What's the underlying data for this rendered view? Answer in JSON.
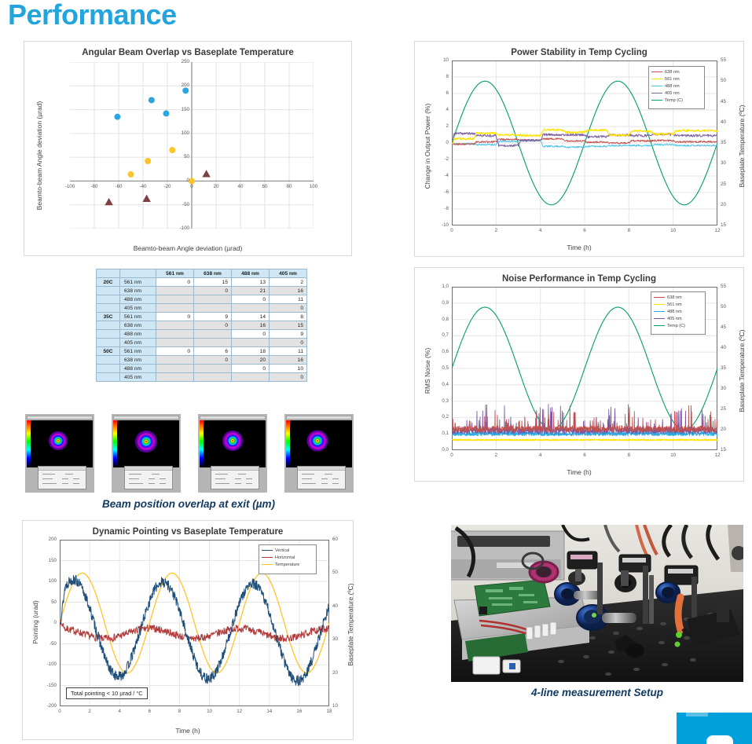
{
  "slide": {
    "title": "Performance"
  },
  "captions": {
    "beam_overlap": "Beam position overlap at exit (µm)",
    "setup": "4-line measurement Setup"
  },
  "scatter_chart": {
    "chart_data": {
      "type": "scatter",
      "title": "Angular Beam Overlap vs Baseplate Temperature",
      "xlabel": "Beamto-beam Angle deviation (µrad)",
      "ylabel": "Beamto-beam Angle deviation (µrad)",
      "xlim": [
        -100,
        100
      ],
      "ylim": [
        -100,
        250
      ],
      "xticks": [
        -100,
        -80,
        -60,
        -40,
        -20,
        0,
        20,
        40,
        60,
        80,
        100
      ],
      "yticks": [
        -100,
        -50,
        0,
        50,
        100,
        150,
        200,
        250
      ],
      "grid": true,
      "series": [
        {
          "name": "blue-circles",
          "color": "#2BA6DE",
          "marker": "circle",
          "points": [
            [
              -61,
              135
            ],
            [
              -33,
              170
            ],
            [
              -21,
              142
            ],
            [
              -5,
              190
            ]
          ]
        },
        {
          "name": "yellow-circles",
          "color": "#FFC425",
          "marker": "circle",
          "points": [
            [
              -50,
              14
            ],
            [
              -36,
              42
            ],
            [
              -16,
              65
            ],
            [
              0,
              0
            ]
          ]
        },
        {
          "name": "brown-triangles",
          "color": "#7D4141",
          "marker": "triangle",
          "points": [
            [
              -68,
              -44
            ],
            [
              -37,
              -37
            ],
            [
              12,
              15
            ]
          ]
        }
      ]
    }
  },
  "power_chart": {
    "chart_data": {
      "type": "line",
      "title": "Power Stability in Temp Cycling",
      "xlabel": "Time (h)",
      "ylabel": "Change in Output Power (%)",
      "y2label": "Baseplate Temperature (ºC)",
      "xlim": [
        0,
        12
      ],
      "ylim": [
        -10,
        10
      ],
      "y2lim": [
        15,
        55
      ],
      "xticks": [
        0,
        2,
        4,
        6,
        8,
        10,
        12
      ],
      "yticks": [
        -10,
        -8,
        -6,
        -4,
        -2,
        0,
        2,
        4,
        6,
        8,
        10
      ],
      "y2ticks": [
        15,
        20,
        25,
        30,
        35,
        40,
        45,
        50,
        55
      ],
      "grid": true,
      "legend_position": "top-right",
      "series": [
        {
          "name": "638 nm",
          "color": "#C0504D",
          "axis": "left",
          "band": [
            -0.3,
            0.6
          ]
        },
        {
          "name": "561 nm",
          "color": "#FFE400",
          "axis": "left",
          "band": [
            -0.9,
            1.8
          ]
        },
        {
          "name": "488 nm",
          "color": "#4FC3E8",
          "axis": "left",
          "band": [
            -0.8,
            0.4
          ]
        },
        {
          "name": "405 nm",
          "color": "#8064A2",
          "axis": "left",
          "band": [
            -0.7,
            1.4
          ]
        },
        {
          "name": "Temp (C)",
          "color": "#00A060",
          "axis": "right",
          "description": "sinusoid 35 ºC mean, amplitude 15 ºC, period 6 h, peaks at 1.5 h and 7.5 h (50 ºC), troughs at 4.5 h and 10.5 h (20 ºC)"
        }
      ]
    }
  },
  "noise_chart": {
    "chart_data": {
      "type": "line",
      "title": "Noise Performance in Temp Cycling",
      "xlabel": "Time (h)",
      "ylabel": "RMS Noise (%)",
      "y2label": "Baseplate Temperature (ºC)",
      "xlim": [
        0,
        12
      ],
      "ylim": [
        0.0,
        1.0
      ],
      "y2lim": [
        15,
        55
      ],
      "xticks": [
        0,
        2,
        4,
        6,
        8,
        10,
        12
      ],
      "yticks": [
        "0,0",
        "0,1",
        "0,2",
        "0,3",
        "0,4",
        "0,5",
        "0,6",
        "0,7",
        "0,8",
        "0,9",
        "1,0"
      ],
      "y2ticks": [
        15,
        20,
        25,
        30,
        35,
        40,
        45,
        50,
        55
      ],
      "grid": true,
      "legend_position": "top-right",
      "series": [
        {
          "name": "638 nm",
          "color": "#C0504D",
          "axis": "left",
          "band": [
            0.12,
            0.27
          ]
        },
        {
          "name": "561 nm",
          "color": "#FFE400",
          "axis": "left",
          "band": [
            0.05,
            0.07
          ]
        },
        {
          "name": "488 nm",
          "color": "#29ABE2",
          "axis": "left",
          "band": [
            0.08,
            0.12
          ]
        },
        {
          "name": "405 nm",
          "color": "#7B54A3",
          "axis": "left",
          "band": [
            0.1,
            0.29
          ]
        },
        {
          "name": "Temp (C)",
          "color": "#00A060",
          "axis": "right",
          "description": "sinusoid 35 ºC mean, amplitude 15 ºC, period 6 h, peaks at 1.5 h and 7.5 h (50 ºC), troughs at 4.5 h and 10.5 h (20 ºC)"
        }
      ]
    }
  },
  "pointing_chart": {
    "chart_data": {
      "type": "line",
      "title": "Dynamic Pointing  vs Baseplate Temperature",
      "xlabel": "Time (h)",
      "ylabel": "Pointing (urad)",
      "y2label": "Baseplate Temperature (ºC)",
      "xlim": [
        0,
        18
      ],
      "ylim": [
        -200,
        200
      ],
      "y2lim": [
        10,
        60
      ],
      "xticks": [
        0,
        2,
        4,
        6,
        8,
        10,
        12,
        14,
        16,
        18
      ],
      "yticks": [
        -200,
        -150,
        -100,
        -50,
        0,
        50,
        100,
        150,
        200
      ],
      "y2ticks": [
        10,
        20,
        30,
        40,
        50,
        60
      ],
      "grid": true,
      "legend_position": "top-right",
      "annotation": "Total pointing < 10 µrad / °C",
      "series": [
        {
          "name": "Vertical",
          "color": "#1F4E79",
          "axis": "left",
          "band": [
            -140,
            120
          ]
        },
        {
          "name": "Horizontal",
          "color": "#B33A3A",
          "axis": "left",
          "band": [
            -50,
            5
          ]
        },
        {
          "name": "Temperature",
          "color": "#FFC425",
          "axis": "right",
          "description": "sinusoid 35 ºC mean, amplitude 15 ºC, period 6 h, peaks near 1.5, 7.5, 13.5 h"
        }
      ]
    }
  },
  "crosstalk_table": {
    "columns": [
      "",
      "",
      "561 nm",
      "638 nm",
      "488 nm",
      "405 nm"
    ],
    "groups": [
      {
        "temperature": "20C",
        "rows": [
          {
            "wavelength": "561 nm",
            "values": [
              "0",
              "15",
              "13",
              "2"
            ]
          },
          {
            "wavelength": "638 nm",
            "values": [
              "",
              "0",
              "21",
              "16"
            ]
          },
          {
            "wavelength": "488 nm",
            "values": [
              "",
              "",
              "0",
              "11"
            ]
          },
          {
            "wavelength": "405 nm",
            "values": [
              "",
              "",
              "",
              "0"
            ]
          }
        ]
      },
      {
        "temperature": "35C",
        "rows": [
          {
            "wavelength": "561 nm",
            "values": [
              "0",
              "9",
              "14",
              "8"
            ]
          },
          {
            "wavelength": "638 nm",
            "values": [
              "",
              "0",
              "16",
              "15"
            ]
          },
          {
            "wavelength": "488 nm",
            "values": [
              "",
              "",
              "0",
              "9"
            ]
          },
          {
            "wavelength": "405 nm",
            "values": [
              "",
              "",
              "",
              "0"
            ]
          }
        ]
      },
      {
        "temperature": "50C",
        "rows": [
          {
            "wavelength": "561 nm",
            "values": [
              "0",
              "6",
              "18",
              "11"
            ]
          },
          {
            "wavelength": "638 nm",
            "values": [
              "",
              "0",
              "20",
              "16"
            ]
          },
          {
            "wavelength": "488 nm",
            "values": [
              "",
              "",
              "0",
              "10"
            ]
          },
          {
            "wavelength": "405 nm",
            "values": [
              "",
              "",
              "",
              "0"
            ]
          }
        ]
      }
    ]
  },
  "beam_images": [
    {
      "name": "beam-profile-1"
    },
    {
      "name": "beam-profile-2"
    },
    {
      "name": "beam-profile-3"
    },
    {
      "name": "beam-profile-4"
    }
  ],
  "colors": {
    "title_blue": "#22A5DC",
    "caption_navy": "#123A63",
    "logo_blue": "#00A0DC",
    "table_header": "#CFE7F5"
  }
}
